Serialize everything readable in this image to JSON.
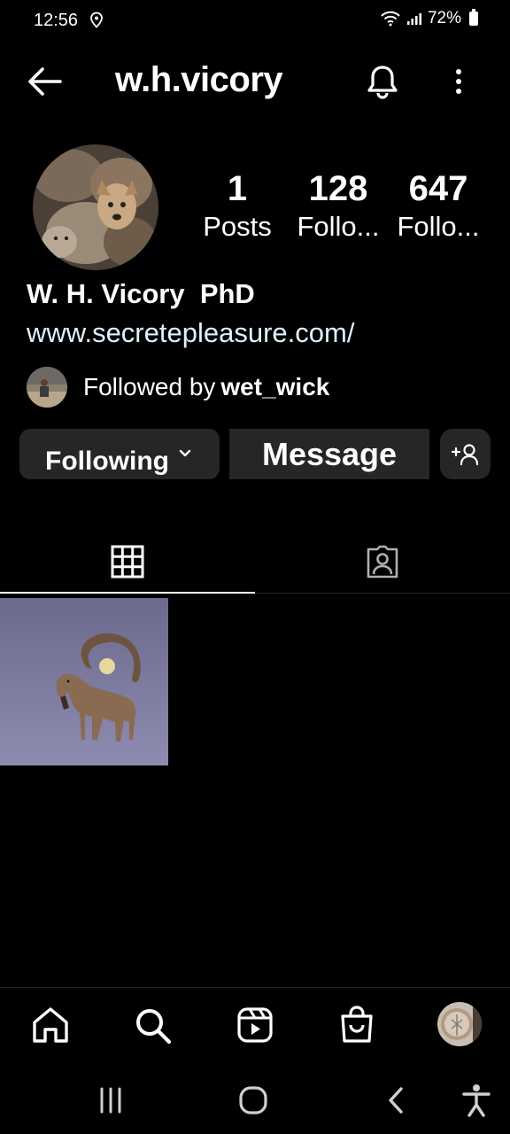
{
  "status_bar": {
    "time": "12:56",
    "battery": "72%"
  },
  "header": {
    "username": "w.h.vicory"
  },
  "profile": {
    "stats": [
      {
        "value": "1",
        "label": "Posts"
      },
      {
        "value": "128",
        "label": "Follo..."
      },
      {
        "value": "647",
        "label": "Follo..."
      }
    ],
    "display_name": "W. H. Vicory  PhD",
    "website": "www.secretepleasure.com/",
    "followed_by_prefix": "Followed by",
    "followed_by_user": "wet_wick"
  },
  "buttons": {
    "following": "Following",
    "message": "Message"
  },
  "tabs": {
    "active": "grid"
  },
  "icons": {
    "back": "arrow-left-icon",
    "notifications": "bell-icon",
    "more": "more-vertical-icon",
    "add_user": "add-user-icon",
    "grid": "grid-icon",
    "tagged": "tagged-person-icon",
    "home": "home-icon",
    "search": "search-icon",
    "reels": "reels-icon",
    "shop": "shop-bag-icon"
  },
  "colors": {
    "background": "#000000",
    "button": "#262626",
    "link": "#e0f1ff"
  }
}
